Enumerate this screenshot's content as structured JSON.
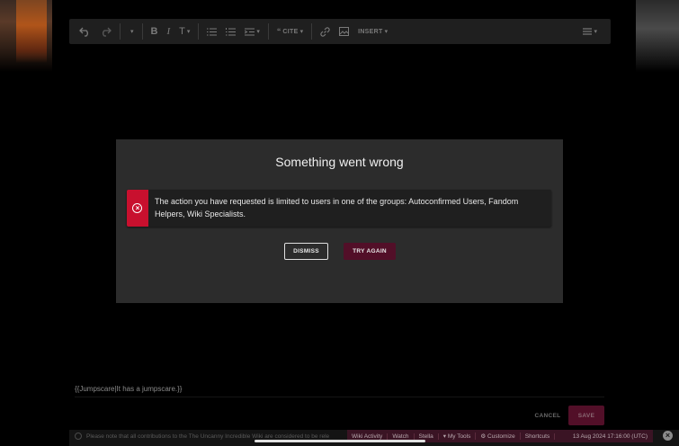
{
  "toolbar": {
    "undo_icon": "undo-icon",
    "redo_icon": "redo-icon",
    "cite_label": "CITE",
    "insert_label": "INSERT"
  },
  "dialog": {
    "title": "Something went wrong",
    "error_message": "The action you have requested is limited to users in one of the groups: Autoconfirmed Users, Fandom Helpers, Wiki Specialists.",
    "dismiss_label": "DISMISS",
    "try_again_label": "TRY AGAIN",
    "error_color": "#c8102e",
    "accent_color": "#520f28"
  },
  "editor": {
    "content": "{{Jumpscare|It has a jumpscare.}}",
    "cancel_label": "CANCEL",
    "save_label": "SAVE"
  },
  "footer": {
    "notice": "Please note that all contributions to the The Uncanny Incredible Wiki are considered to be rele",
    "wiki_activity": "Wiki Activity",
    "watch": "Watch",
    "user": "Stella",
    "my_tools": "My Tools",
    "customize": "Customize",
    "shortcuts": "Shortcuts",
    "timestamp": "13 Aug 2024 17:16:00 (UTC)"
  }
}
